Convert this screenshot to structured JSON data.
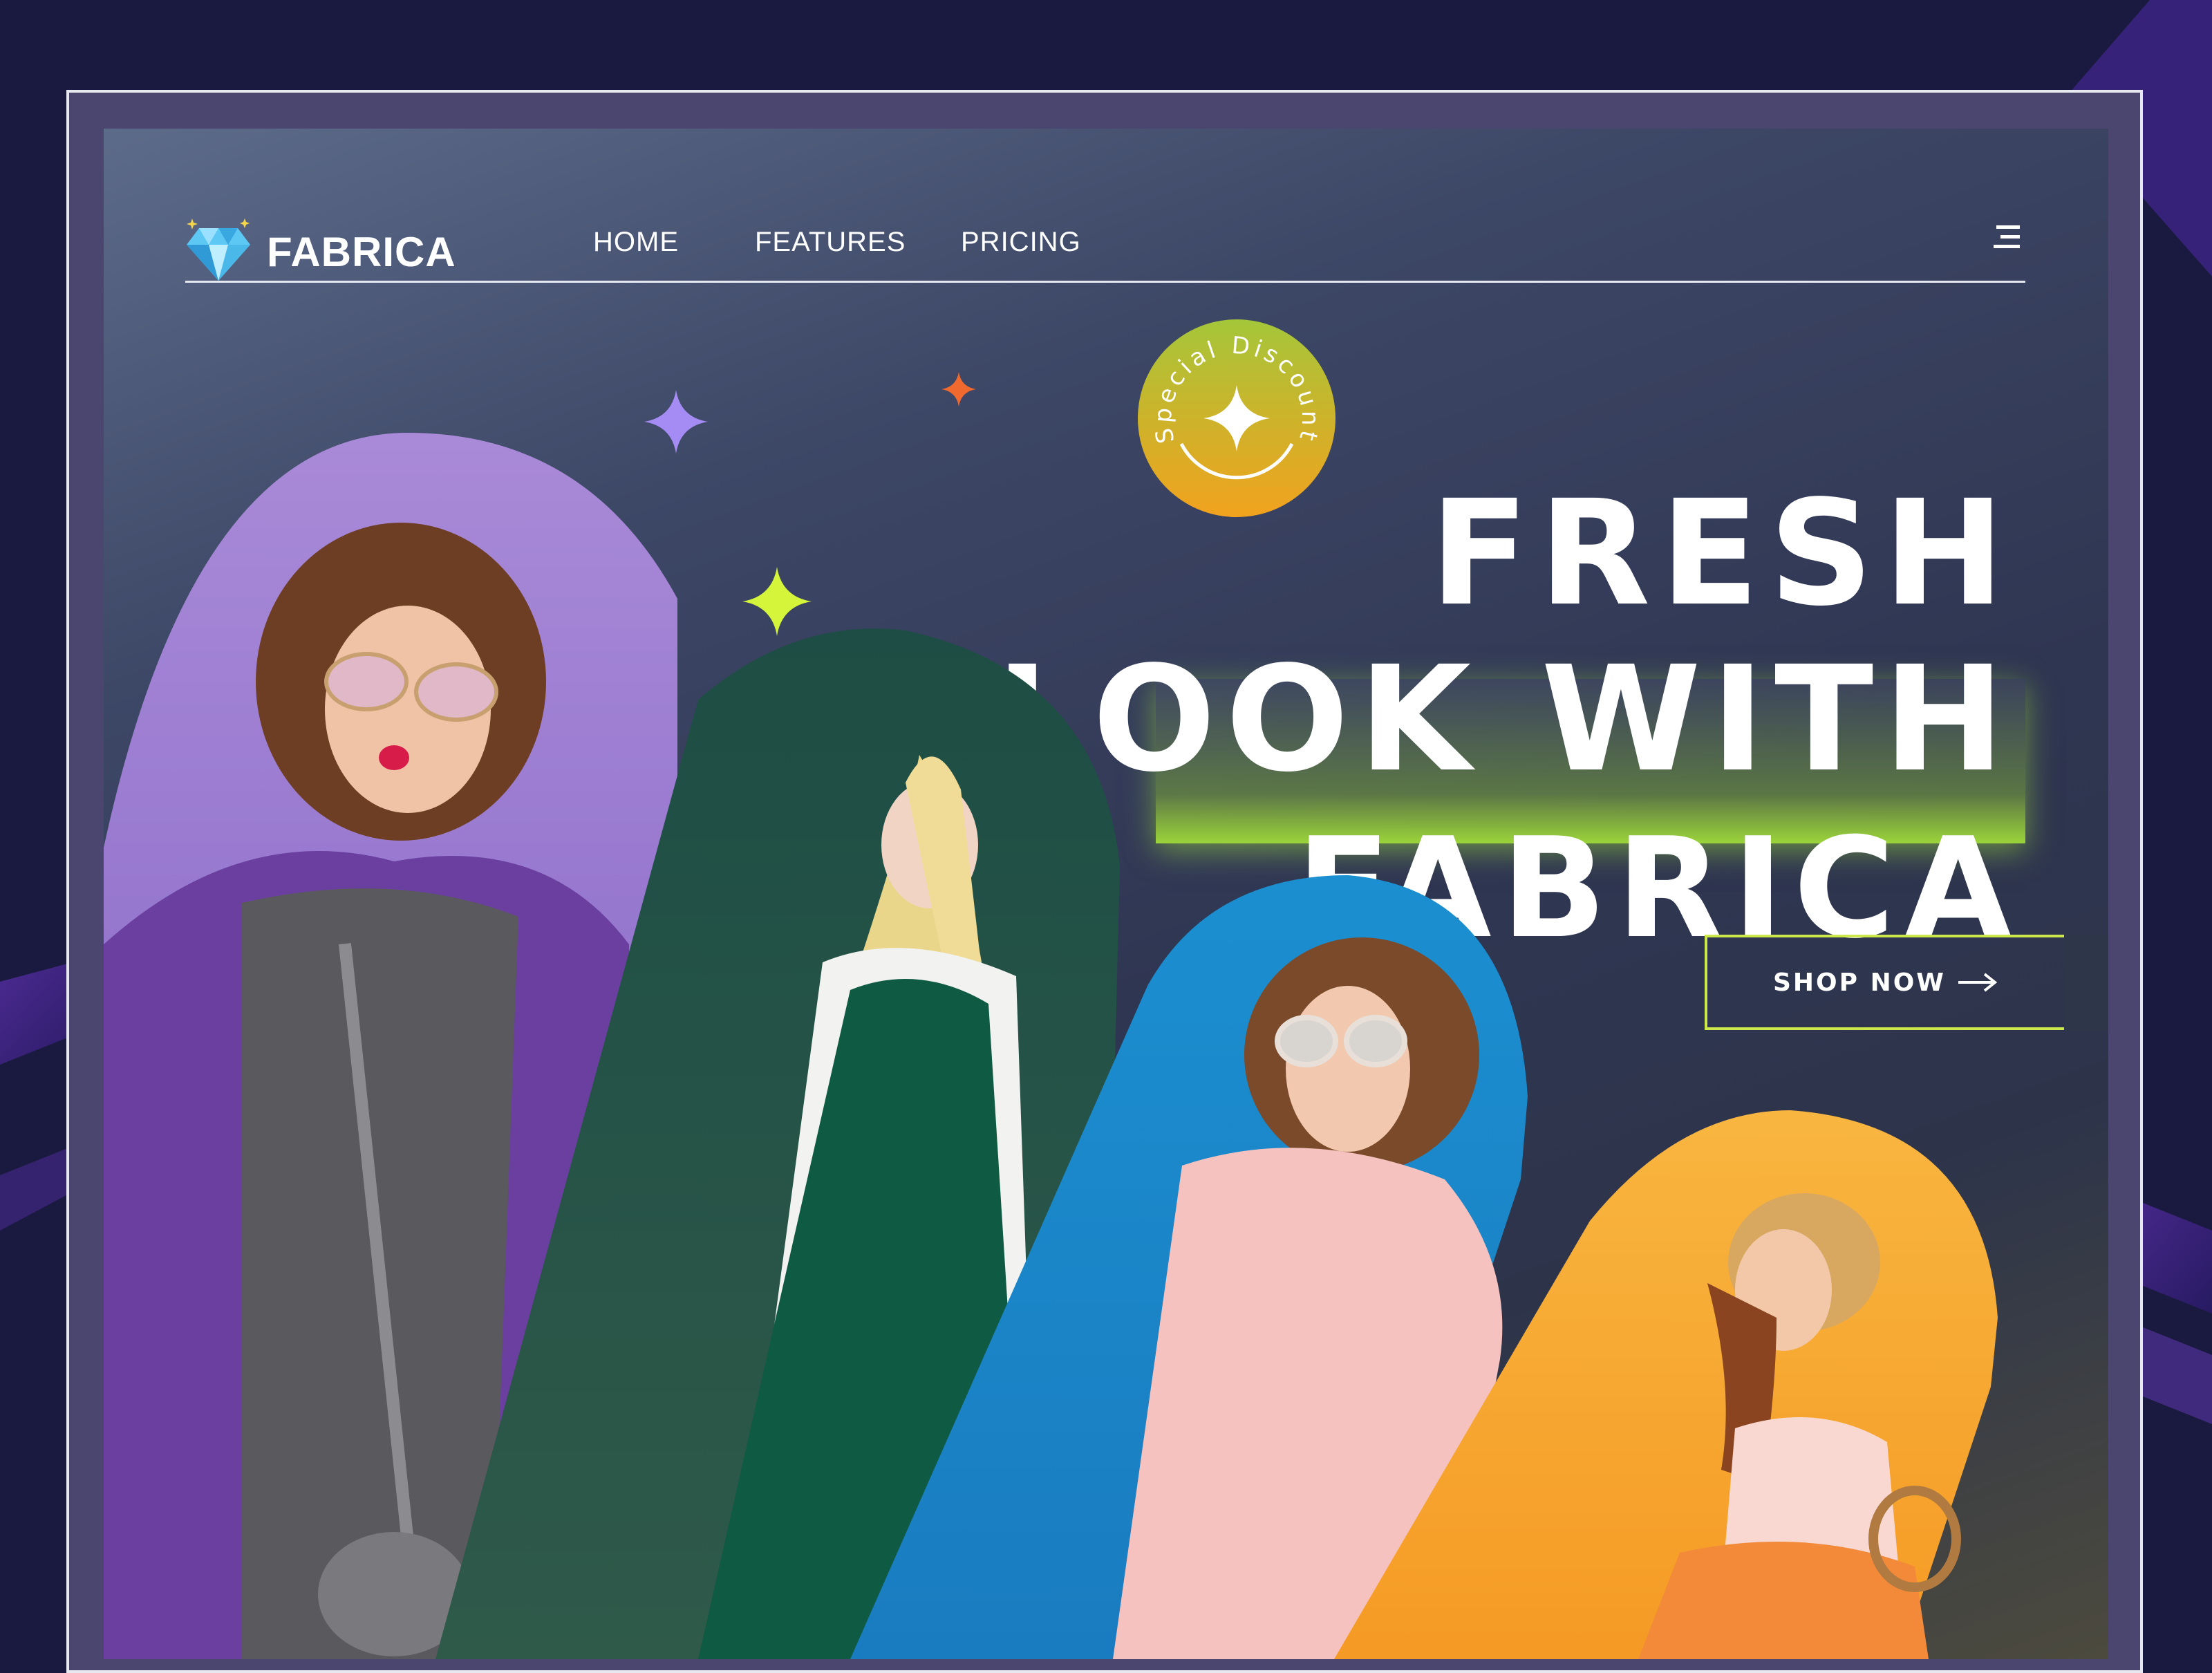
{
  "brand": {
    "name": "FABRICA"
  },
  "nav": {
    "links": [
      {
        "label": "HOME"
      },
      {
        "label": "FEATURES"
      },
      {
        "label": "PRICING"
      }
    ]
  },
  "hero": {
    "line1": "FRESH",
    "line2": "LOOK WITH",
    "line3": "FABRICA",
    "badge_text": "Special Discount",
    "cta_label": "SHOP NOW"
  },
  "icons": {
    "logo": "diamond-icon",
    "menu": "hamburger-menu-icon",
    "cta": "arrow-right-icon",
    "badge": "four-point-star-icon"
  },
  "colors": {
    "outer_background": "#1a1a40",
    "page_gradient_top": "#5d6b8a",
    "page_gradient_bottom": "#2d344a",
    "accent_lime": "#cde84a",
    "highlight_green": "#9bd43a",
    "badge_yellow": "#f2a21e",
    "purple_panel": "#9b7fd0",
    "green_panel": "#1e4a40",
    "blue_panel": "#1b8fd0",
    "orange_panel": "#f5a93a",
    "sparkle_purple": "#a58cf5",
    "sparkle_orange": "#f06a30",
    "sparkle_lime": "#d4f53a"
  },
  "images": [
    {
      "name": "model-purple-fur-coat"
    },
    {
      "name": "model-green-jumpsuit"
    },
    {
      "name": "model-pink-dress-phone"
    },
    {
      "name": "model-straw-hat"
    }
  ]
}
